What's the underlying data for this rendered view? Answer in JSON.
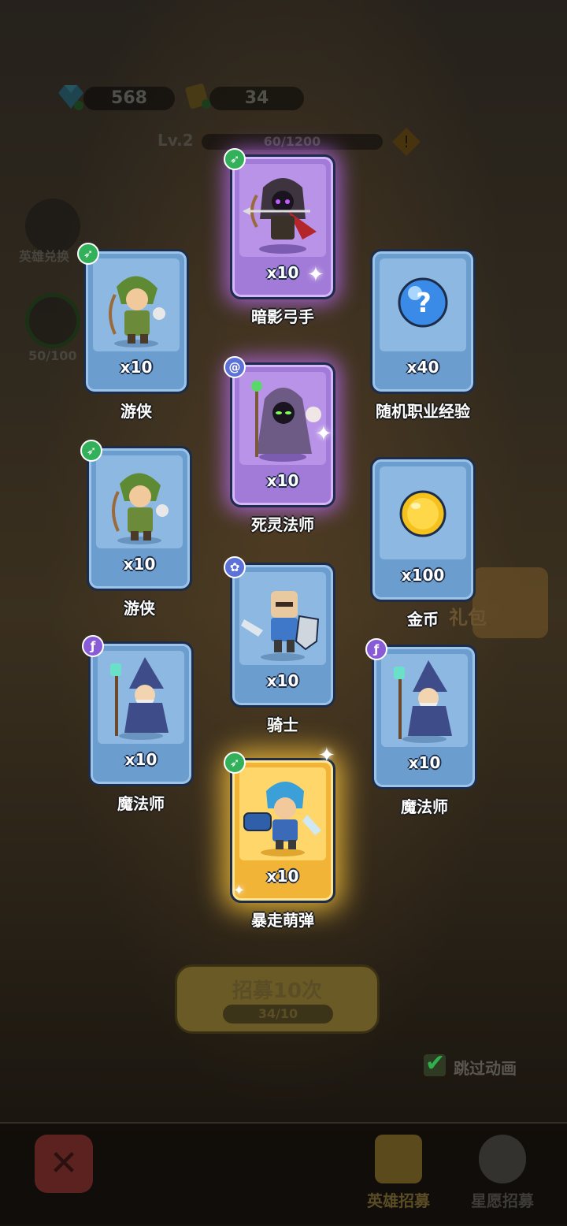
{
  "top": {
    "gems": "568",
    "tickets": "34",
    "level_label": "Lv.2",
    "level_progress": "60/1200",
    "hero_exchange_label": "英雄兑换",
    "star_progress": "50/100"
  },
  "cards": [
    {
      "name": "暗影弓手",
      "qty": "x10",
      "rarity": "purple",
      "badge": "bow-icon"
    },
    {
      "name": "游侠",
      "qty": "x10",
      "rarity": "blue",
      "badge": "bow-icon"
    },
    {
      "name": "随机职业经验",
      "qty": "x40",
      "rarity": "blue",
      "badge": ""
    },
    {
      "name": "死灵法师",
      "qty": "x10",
      "rarity": "purple",
      "badge": "swirl-icon"
    },
    {
      "name": "游侠",
      "qty": "x10",
      "rarity": "blue",
      "badge": "bow-icon"
    },
    {
      "name": "金币",
      "qty": "x100",
      "rarity": "blue",
      "badge": ""
    },
    {
      "name": "骑士",
      "qty": "x10",
      "rarity": "blue",
      "badge": "paw-icon"
    },
    {
      "name": "魔法师",
      "qty": "x10",
      "rarity": "blue",
      "badge": "wand-icon"
    },
    {
      "name": "魔法师",
      "qty": "x10",
      "rarity": "blue",
      "badge": "wand-icon"
    },
    {
      "name": "暴走萌弹",
      "qty": "x10",
      "rarity": "gold",
      "badge": "bow-icon"
    }
  ],
  "gift_label": "礼包",
  "recruit": {
    "label": "招募10次",
    "cost": "34/10"
  },
  "skip_animation": "跳过动画",
  "tabs": {
    "hero_recruit": "英雄招募",
    "star_wish": "星愿招募"
  },
  "colors": {
    "purple": "#a27ad8",
    "blue": "#6b9ecf",
    "gold": "#f1b437"
  }
}
